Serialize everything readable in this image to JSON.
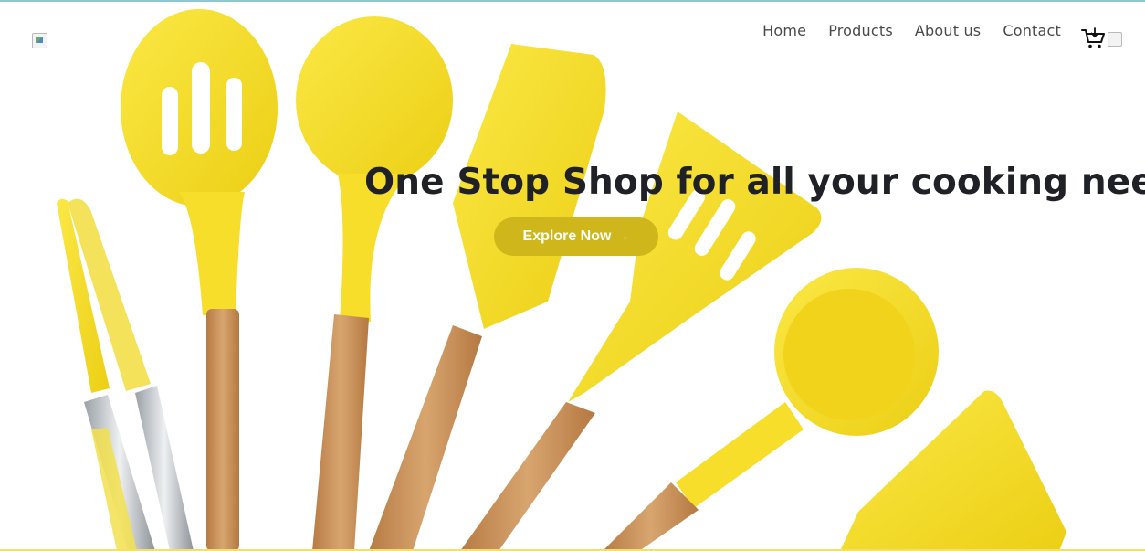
{
  "header": {
    "nav": [
      {
        "label": "Home"
      },
      {
        "label": "Products"
      },
      {
        "label": "About us"
      },
      {
        "label": "Contact"
      }
    ]
  },
  "hero": {
    "headline": "One Stop Shop for all your cooking needs",
    "cta_label": "Explore Now",
    "cta_arrow": "→"
  },
  "icons": [
    "logo-image",
    "cart-icon",
    "user-avatar-image"
  ],
  "colors": {
    "accent": "#cfb71b",
    "utensil_yellow": "#f4df2f",
    "wood": "#cf9a62",
    "text": "#1f2126"
  }
}
